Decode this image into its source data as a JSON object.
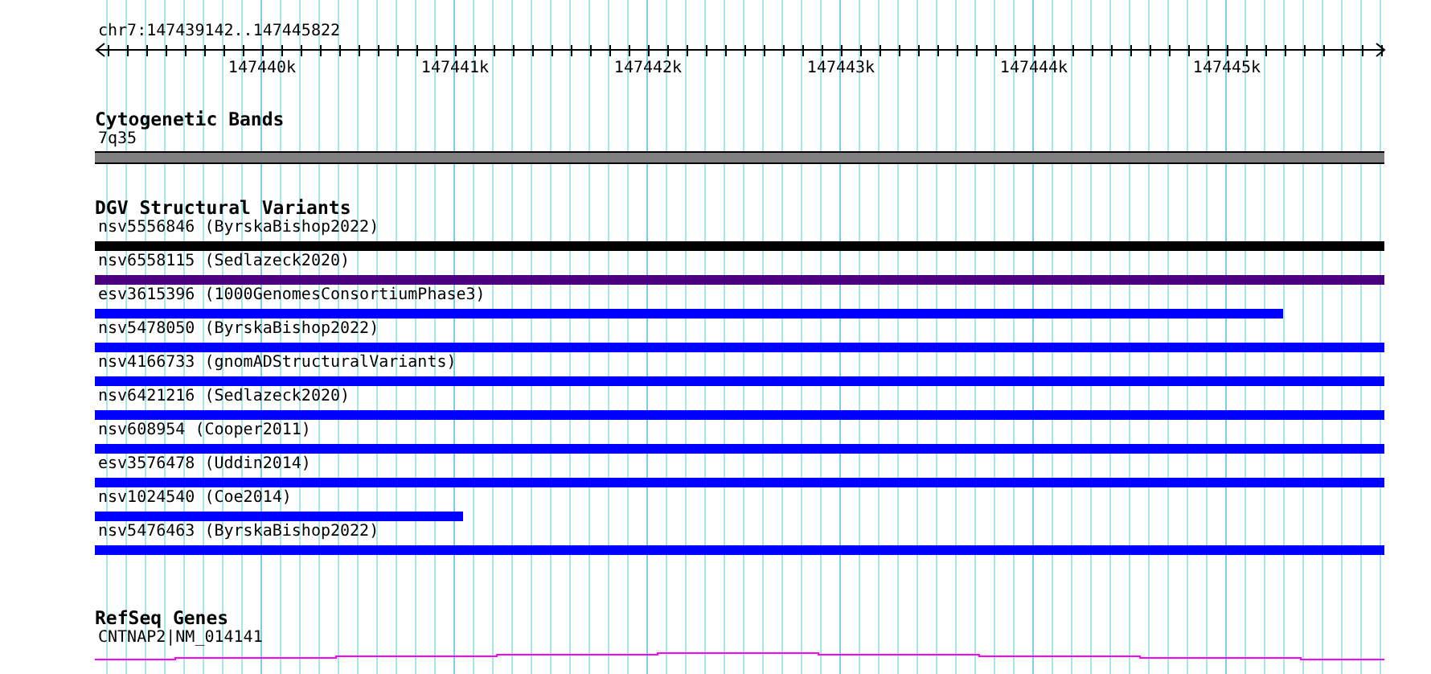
{
  "ruler": {
    "location": "chr7:147439142..147445822",
    "ticks": [
      "147440k",
      "147441k",
      "147442k",
      "147443k",
      "147444k",
      "147445k"
    ]
  },
  "tracks": [
    {
      "kind": "bands",
      "title": "Cytogenetic Bands",
      "features": [
        {
          "label": "7q35",
          "color": "#808080",
          "level": 1
        }
      ]
    },
    {
      "kind": "variants",
      "title": "DGV Structural Variants",
      "features": [
        {
          "label": "nsv5556846 (ByrskaBishop2022)",
          "color": "#000000",
          "level": 1
        },
        {
          "label": "nsv6558115 (Sedlazeck2020)",
          "color": "#4b0082",
          "level": 1
        },
        {
          "label": "esv3615396 (1000GenomesConsortiumPhase3)",
          "color": "#0000ff",
          "level": 0.921
        },
        {
          "label": "nsv5478050 (ByrskaBishop2022)",
          "color": "#0000ff",
          "level": 1
        },
        {
          "label": "nsv4166733 (gnomADStructuralVariants)",
          "color": "#0000ff",
          "level": 1
        },
        {
          "label": "nsv6421216 (Sedlazeck2020)",
          "color": "#0000ff",
          "level": 1
        },
        {
          "label": "nsv608954 (Cooper2011)",
          "color": "#0000ff",
          "level": 1
        },
        {
          "label": "esv3576478 (Uddin2014)",
          "color": "#0000ff",
          "level": 1
        },
        {
          "label": "nsv1024540 (Coe2014)",
          "color": "#0000ff",
          "level": 0.286
        },
        {
          "label": "nsv5476463 (ByrskaBishop2022)",
          "color": "#0000ff",
          "level": 1
        }
      ]
    },
    {
      "kind": "gene",
      "title": "RefSeq Genes",
      "features": [
        {
          "label": "CNTNAP2|NM_014141",
          "color": "#ff00ff"
        }
      ]
    }
  ]
}
